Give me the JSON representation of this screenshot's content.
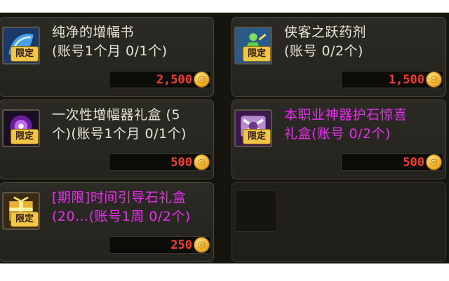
{
  "items": [
    {
      "name": "纯净的增幅书",
      "limit": "(账号1个月 0/1个)",
      "badge": "限定",
      "price": "2,500",
      "color": "white",
      "icon": "book-icon"
    },
    {
      "name": "侠客之跃药剂",
      "limit": "(账号 0/2个)",
      "badge": "限定",
      "price": "1,500",
      "color": "white",
      "icon": "leaping-figure-icon"
    },
    {
      "name": "一次性增幅器礼盒 (5",
      "limit": "个)(账号1个月 0/1个)",
      "badge": "限定",
      "price": "500",
      "color": "white",
      "icon": "purple-orb-box-icon"
    },
    {
      "name": "本职业神器护石惊喜",
      "limit": "礼盒(账号 0/2个)",
      "badge": "限定",
      "price": "500",
      "color": "pink",
      "icon": "artifact-stone-box-icon"
    },
    {
      "name": "[期限]时间引导石礼盒",
      "limit": "(20...(账号1周 0/2个)",
      "badge": "限定",
      "price": "250",
      "color": "pink",
      "icon": "gold-gift-box-icon"
    }
  ],
  "colors": {
    "white_text": "#e8e6d6",
    "pink_text": "#ea2ef0",
    "price_text": "#ff3b2a",
    "badge_bg": "#f1c548"
  }
}
